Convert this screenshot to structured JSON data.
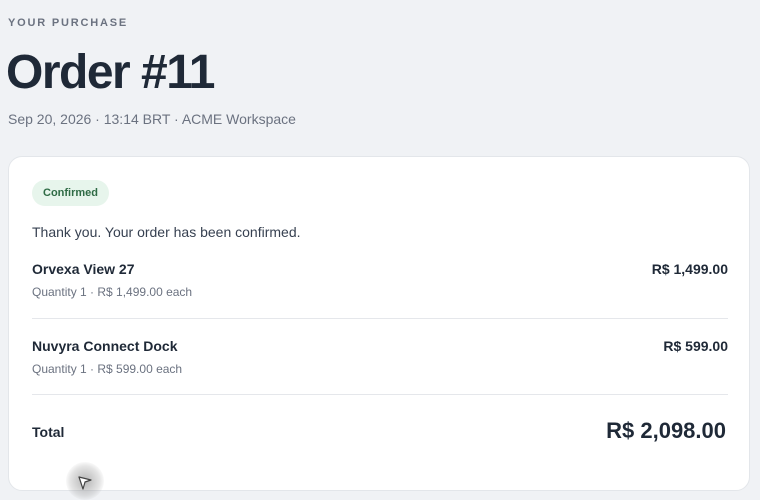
{
  "header": {
    "eyebrow": "YOUR PURCHASE",
    "title": "Order #11",
    "meta": "Sep 20, 2026 · 13:14 BRT · ACME Workspace"
  },
  "order": {
    "status": "Confirmed",
    "message": "Thank you. Your order has been confirmed.",
    "items": [
      {
        "name": "Orvexa View 27",
        "price": "R$ 1,499.00",
        "detail": "Quantity 1 · R$ 1,499.00 each"
      },
      {
        "name": "Nuvyra Connect Dock",
        "price": "R$ 599.00",
        "detail": "Quantity 1 · R$ 599.00 each"
      }
    ],
    "total_label": "Total",
    "total_value": "R$ 2,098.00"
  },
  "colors": {
    "background": "#f0f2f5",
    "card": "#ffffff",
    "badge_bg": "#e7f5ec",
    "badge_text": "#2f6b45",
    "text_primary": "#1f2937",
    "text_muted": "#6b7280"
  },
  "icons": {
    "cursor": "pointer-cursor-icon"
  }
}
